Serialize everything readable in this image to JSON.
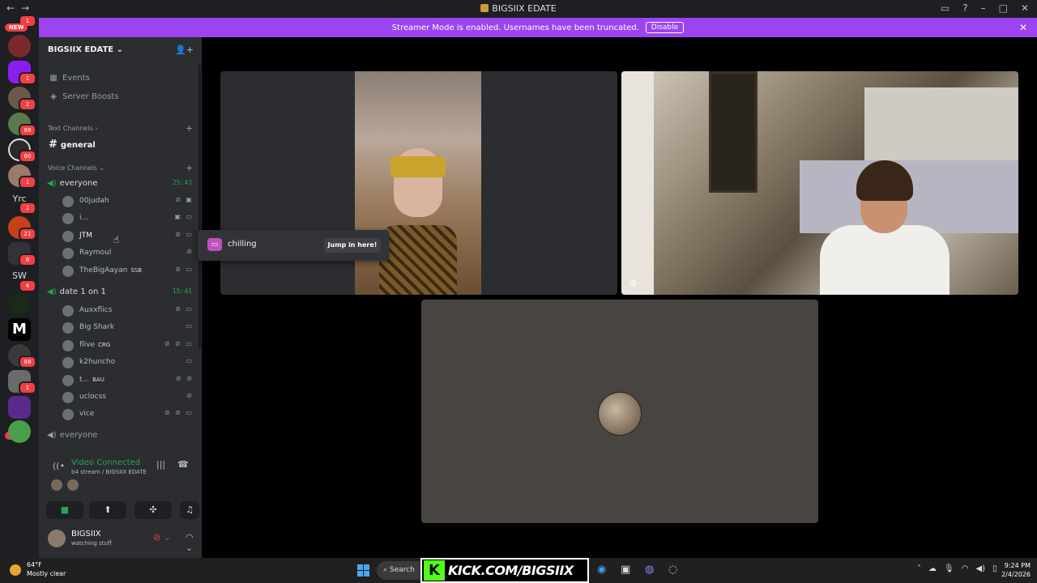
{
  "window": {
    "title": "BIGSIIX EDATE"
  },
  "banner": {
    "text": "Streamer Mode is enabled. Usernames have been truncated.",
    "disable_label": "Disable"
  },
  "rail": {
    "top_badge": "1",
    "new_top": "NEW",
    "badges": [
      "1",
      "2",
      "89",
      "60",
      "1",
      "1",
      "21",
      "8",
      "4",
      "88",
      "1"
    ],
    "text_servers": [
      "Yrc",
      "SW",
      "M"
    ],
    "new_bottom": "NEW"
  },
  "server": {
    "name": "BIGSIIX EDATE",
    "items": [
      {
        "label": "Events",
        "icon": "calendar-icon"
      },
      {
        "label": "Server Boosts",
        "icon": "boost-icon"
      }
    ],
    "text_category": "Text Channels",
    "general": "general",
    "voice_category": "Voice Channels",
    "voice1": {
      "name": "everyone",
      "timer": "25:43",
      "users": [
        {
          "name": "00judah",
          "tag": "",
          "icons": "⊘ ▣"
        },
        {
          "name": "i...",
          "tag": "",
          "icons": "▣ ▭"
        },
        {
          "name": "JTM",
          "tag": "",
          "icons": "⊘ ▭"
        },
        {
          "name": "Raymoul",
          "tag": "",
          "icons": "⊘"
        },
        {
          "name": "TheBigAayan",
          "tag": "SSB",
          "icons": "⊘ ▭"
        }
      ]
    },
    "voice2": {
      "name": "date 1 on 1",
      "timer": "15:41",
      "users": [
        {
          "name": "Auxxflics",
          "tag": "",
          "icons": "⊘ ▭"
        },
        {
          "name": "Big Shark",
          "tag": "",
          "icons": "▭"
        },
        {
          "name": "flive",
          "tag": "CRG",
          "icons": "⊘ ⊘ ▭"
        },
        {
          "name": "k2huncho",
          "tag": "",
          "icons": "▭"
        },
        {
          "name": "t...",
          "tag": "BAU",
          "icons": "⊘ ⊘"
        },
        {
          "name": "uclocss",
          "tag": "",
          "icons": "⊘"
        },
        {
          "name": "vice",
          "tag": "",
          "icons": "⊘ ⊘ ▭"
        }
      ]
    },
    "voice3": {
      "name": "everyone"
    }
  },
  "voice_panel": {
    "status": "Video Connected",
    "location": "b4 stream / BIGSIIX EDATE"
  },
  "user_bar": {
    "username": "BIGSIIX",
    "status": "watching stuff"
  },
  "popover": {
    "activity": "chilling",
    "jump_label": "Jump in here!"
  },
  "taskbar": {
    "temp": "64°F",
    "weather": "Mostly clear",
    "search": "Search",
    "kick_url": "KICK.COM/BIGSIIX",
    "time": "9:24 PM",
    "date": "2/4/2026"
  }
}
